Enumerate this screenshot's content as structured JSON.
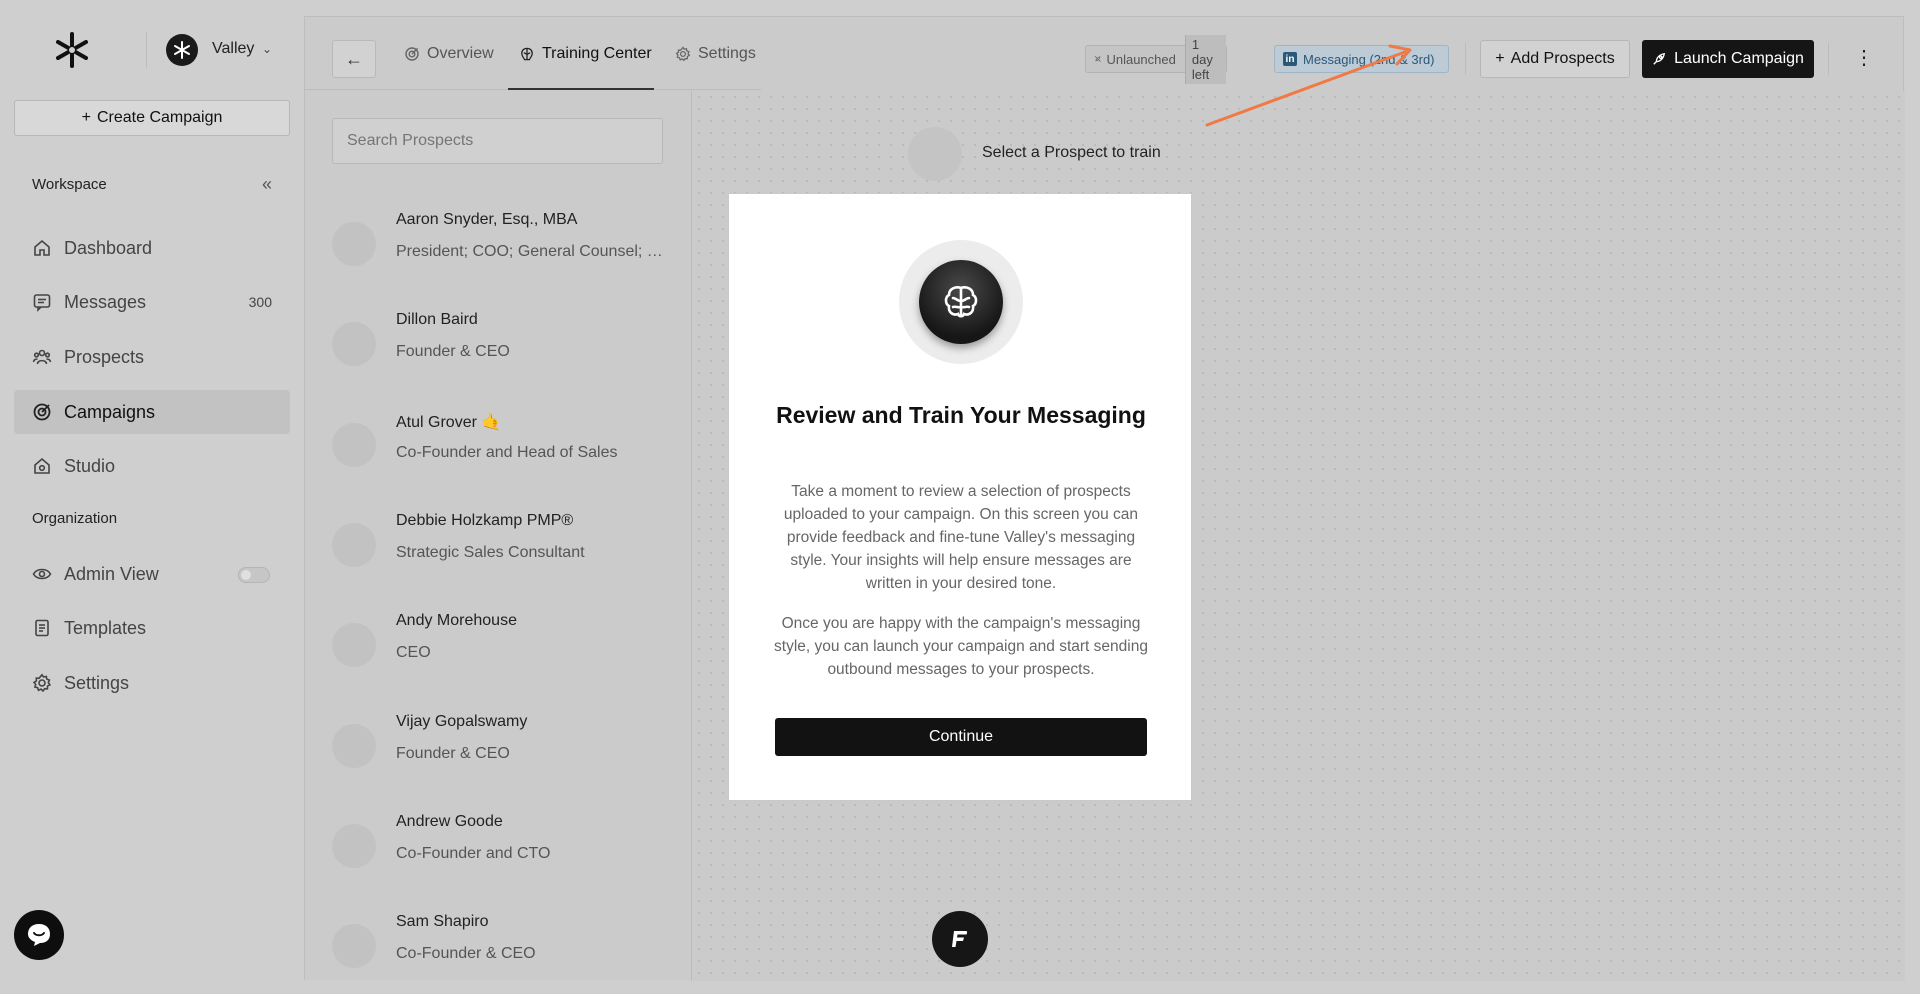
{
  "sidebar": {
    "workspace_name": "Valley",
    "create_label": "Create Campaign",
    "workspace_section": "Workspace",
    "organization_section": "Organization",
    "items": [
      {
        "label": "Dashboard",
        "icon": "home-icon"
      },
      {
        "label": "Messages",
        "icon": "message-icon",
        "badge": "300"
      },
      {
        "label": "Prospects",
        "icon": "people-icon"
      },
      {
        "label": "Campaigns",
        "icon": "target-icon",
        "active": true
      },
      {
        "label": "Studio",
        "icon": "studio-icon"
      },
      {
        "label": "Admin View",
        "icon": "eye-icon",
        "toggle": false
      },
      {
        "label": "Templates",
        "icon": "document-icon"
      },
      {
        "label": "Settings",
        "icon": "gear-icon"
      }
    ]
  },
  "header": {
    "tabs": [
      {
        "label": "Overview",
        "icon": "target-icon"
      },
      {
        "label": "Training Center",
        "icon": "brain-icon",
        "active": true
      },
      {
        "label": "Settings",
        "icon": "gear-icon"
      }
    ],
    "status_label": "Unlaunched",
    "status_sub": "1 day left",
    "channel_label": "Messaging (2nd & 3rd)",
    "add_prospects_label": "Add Prospects",
    "launch_label": "Launch Campaign"
  },
  "search": {
    "placeholder": "Search Prospects"
  },
  "prospects": [
    {
      "name": "Aaron Snyder, Esq., MBA",
      "title": "President; COO; General Counsel; Co..."
    },
    {
      "name": "Dillon Baird",
      "title": "Founder & CEO"
    },
    {
      "name": "Atul Grover 🤙",
      "title": "Co-Founder and Head of Sales"
    },
    {
      "name": "Debbie Holzkamp PMP®",
      "title": "Strategic Sales Consultant"
    },
    {
      "name": "Andy Morehouse",
      "title": "CEO"
    },
    {
      "name": "Vijay Gopalswamy",
      "title": "Founder & CEO"
    },
    {
      "name": "Andrew Goode",
      "title": "Co-Founder and CTO"
    },
    {
      "name": "Sam Shapiro",
      "title": "Co-Founder & CEO"
    }
  ],
  "canvas": {
    "empty_text": "Select a Prospect to train"
  },
  "modal": {
    "title": "Review and Train Your Messaging",
    "paragraph1": "Take a moment to review a selection of prospects uploaded to your campaign. On this screen you can provide feedback and fine-tune Valley's messaging style. Your insights will help ensure messages are written in your desired tone.",
    "paragraph2": "Once you are happy with the campaign's messaging style, you can launch your campaign and start sending outbound messages to your prospects.",
    "button": "Continue"
  },
  "colors": {
    "accent_arrow": "#f07a46",
    "linkedin": "#2b5878"
  }
}
